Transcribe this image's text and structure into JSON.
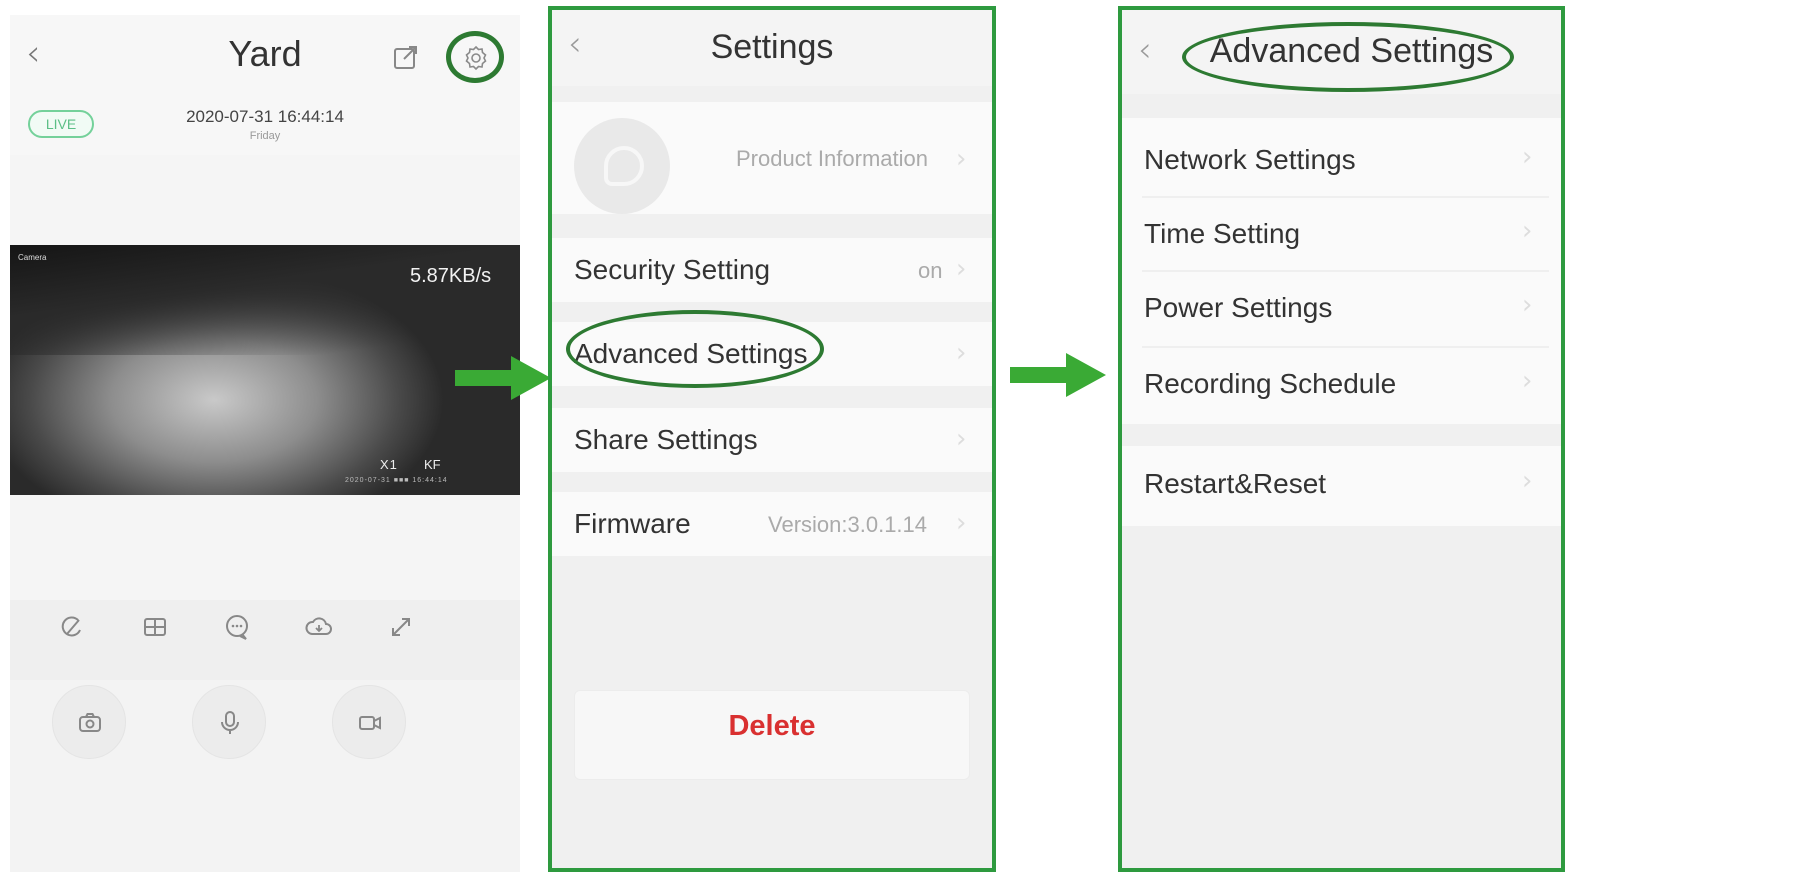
{
  "live_view": {
    "title": "Yard",
    "live_badge": "LIVE",
    "date_time": "2020-07-31 16:44:14",
    "day": "Friday",
    "video": {
      "camera_label": "Camera",
      "bitrate": "5.87KB/s",
      "zoom": "X1",
      "keyframe": "KF",
      "timestamp": "2020-07-31 ■■■ 16:44:14"
    },
    "control_icons": [
      "rotate-icon",
      "grid-icon",
      "chat-icon",
      "cloud-icon",
      "fullscreen-icon"
    ],
    "action_icons": [
      "camera-icon",
      "microphone-icon",
      "video-record-icon"
    ]
  },
  "settings": {
    "title": "Settings",
    "product_info": "Product Information",
    "items": [
      {
        "label": "Security Setting",
        "value": "on"
      },
      {
        "label": "Advanced Settings",
        "value": ""
      },
      {
        "label": "Share Settings",
        "value": ""
      },
      {
        "label": "Firmware",
        "value": "Version:3.0.1.14"
      }
    ],
    "delete_label": "Delete"
  },
  "advanced_settings": {
    "title": "Advanced Settings",
    "items": [
      {
        "label": "Network Settings"
      },
      {
        "label": "Time Setting"
      },
      {
        "label": "Power Settings"
      },
      {
        "label": "Recording Schedule"
      }
    ],
    "reset_label": "Restart&Reset"
  },
  "colors": {
    "highlight": "#2d7a32",
    "panel_border": "#2e9a3f",
    "arrow": "#3aaa35",
    "delete": "#d93030",
    "live_badge": "#5bbf86"
  }
}
